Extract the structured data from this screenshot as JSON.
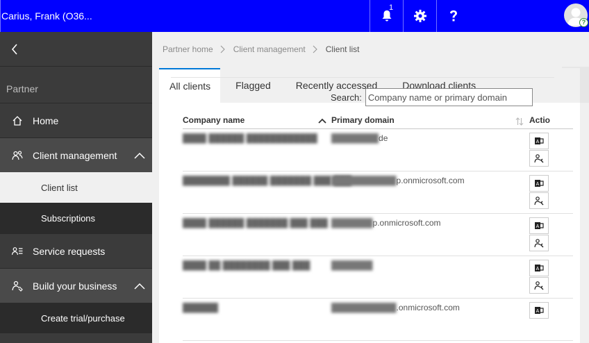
{
  "topbar": {
    "notification_count": "1",
    "user_name": "Carius, Frank (O36...",
    "icons": [
      "bell-icon",
      "gear-icon",
      "help-icon",
      "avatar"
    ],
    "color": "#0000ff"
  },
  "sidebar": {
    "section_title": "Partner",
    "items": [
      {
        "label": "Home",
        "icon": "home-icon"
      },
      {
        "label": "Client management",
        "icon": "people-icon",
        "expanded": true,
        "children": [
          {
            "label": "Client list",
            "selected": true
          },
          {
            "label": "Subscriptions"
          }
        ]
      },
      {
        "label": "Service requests",
        "icon": "service-requests-icon"
      },
      {
        "label": "Build your business",
        "icon": "build-icon",
        "expanded": true,
        "children": [
          {
            "label": "Create trial/purchase"
          }
        ]
      }
    ]
  },
  "breadcrumb": [
    "Partner home",
    "Client management",
    "Client list"
  ],
  "tabs": [
    "All clients",
    "Flagged",
    "Recently accessed",
    "Download clients"
  ],
  "search": {
    "label": "Search:",
    "placeholder": "Company name or primary domain"
  },
  "table": {
    "headers": {
      "company": "Company name",
      "domain": "Primary domain",
      "actions": "Actio"
    },
    "rows": [
      {
        "company": "████ ██████ ████████████",
        "domain_hidden": "████████",
        "domain_visible": "de"
      },
      {
        "company": "████████ ██████ ███████ ███ ███",
        "domain_hidden": "███████████",
        "domain_visible": "p.onmicrosoft.com"
      },
      {
        "company": "████ ██████ ███████ ███ ███",
        "domain_hidden": "███████",
        "domain_visible": "p.onmicrosoft.com"
      },
      {
        "company": "████ ██ ████████ ███ ███",
        "domain_hidden": "███████",
        "domain_visible": ""
      },
      {
        "company": "██████",
        "domain_hidden": "███████████",
        "domain_visible": ".onmicrosoft.com"
      }
    ]
  }
}
